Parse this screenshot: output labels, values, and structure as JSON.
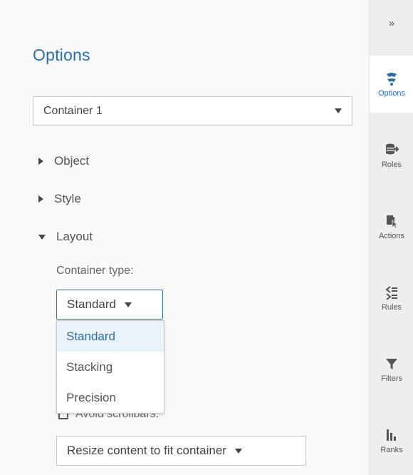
{
  "panel": {
    "title": "Options",
    "object_select": {
      "value": "Container 1"
    },
    "sections": [
      {
        "label": "Object",
        "expanded": false
      },
      {
        "label": "Style",
        "expanded": false
      },
      {
        "label": "Layout",
        "expanded": true
      }
    ],
    "layout": {
      "container_type_label": "Container type:",
      "container_type_value": "Standard",
      "container_type_options": [
        "Standard",
        "Stacking",
        "Precision"
      ],
      "selected_option": "Standard",
      "avoid_scrollbars_label": "Avoid scrollbars:",
      "resize_value": "Resize content to fit container"
    }
  },
  "sidebar": {
    "collapse_label": "»",
    "tabs": [
      {
        "label": "Options",
        "icon": "options-icon",
        "active": true
      },
      {
        "label": "Roles",
        "icon": "roles-icon",
        "active": false
      },
      {
        "label": "Actions",
        "icon": "actions-icon",
        "active": false
      },
      {
        "label": "Rules",
        "icon": "rules-icon",
        "active": false
      },
      {
        "label": "Filters",
        "icon": "filter-icon",
        "active": false
      },
      {
        "label": "Ranks",
        "icon": "ranks-icon",
        "active": false
      }
    ]
  },
  "colors": {
    "accent": "#2f6ea3",
    "selected_bg": "#e9f2fa",
    "sidebar_bg": "#eeeeee",
    "panel_bg": "#f9f9f9"
  }
}
